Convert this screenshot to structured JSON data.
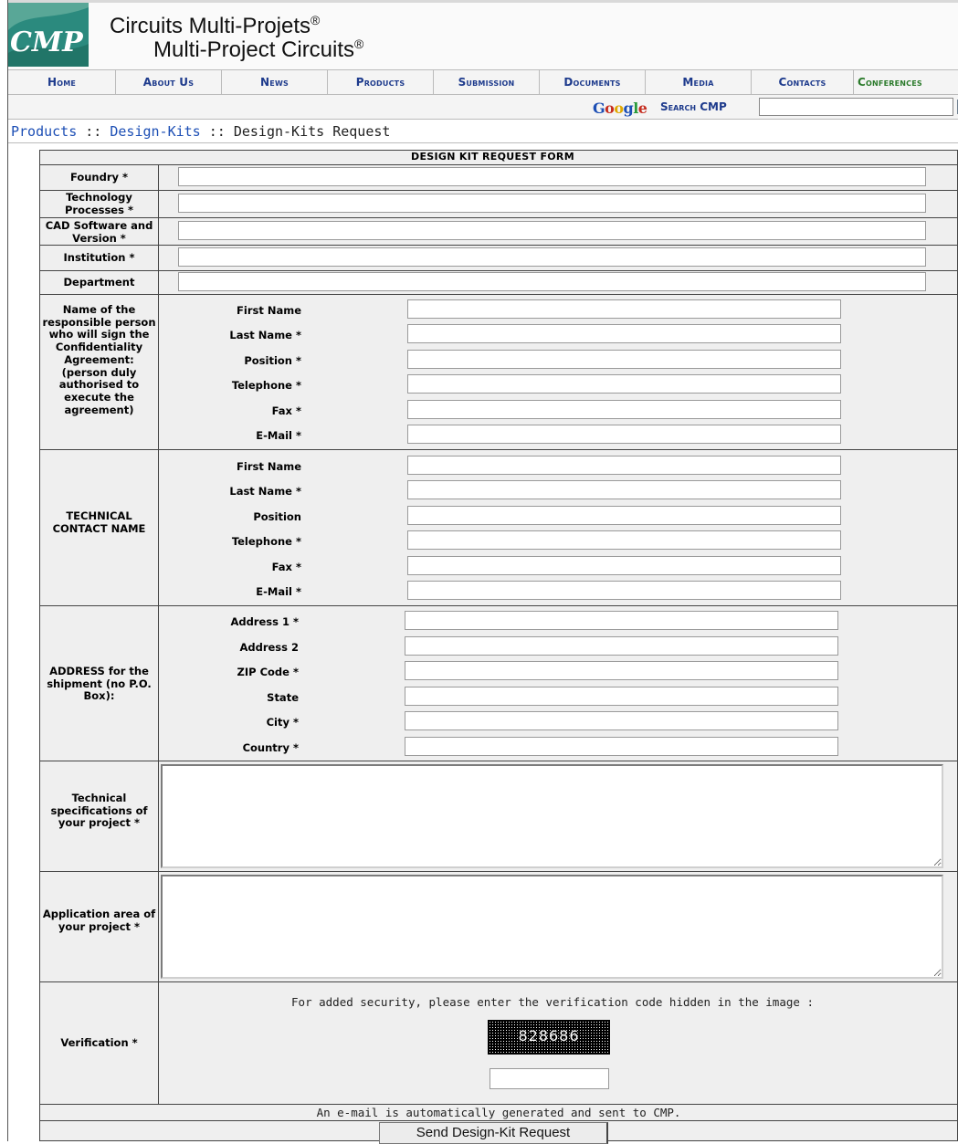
{
  "header": {
    "logo_text": "CMP",
    "title_line1": "Circuits Multi-Projets",
    "title_line2": "Multi-Project Circuits",
    "reg_mark": "®"
  },
  "nav": {
    "items": [
      "Home",
      "About Us",
      "News",
      "Products",
      "Submission",
      "Documents",
      "Media",
      "Contacts",
      "Conferences"
    ]
  },
  "search": {
    "google_label": "Google",
    "search_label": "Search CMP",
    "placeholder": ""
  },
  "breadcrumb": {
    "part1": "Products",
    "sep": " :: ",
    "part2": "Design-Kits",
    "part3": "Design-Kits Request"
  },
  "form": {
    "title": "DESIGN KIT REQUEST FORM",
    "fields": {
      "foundry": "Foundry *",
      "technology": "Technology Processes *",
      "cad": "CAD Software and Version *",
      "institution": "Institution *",
      "department": "Department"
    },
    "responsible": {
      "label": "Name of the responsible person who will sign the Confidentiality Agreement: (person duly authorised to execute the agreement)",
      "first_name": "First Name",
      "last_name": "Last Name *",
      "position": "Position *",
      "telephone": "Telephone *",
      "fax": "Fax *",
      "email": "E-Mail *"
    },
    "technical": {
      "label": "TECHNICAL CONTACT NAME",
      "first_name": "First Name",
      "last_name": "Last Name *",
      "position": "Position",
      "telephone": "Telephone *",
      "fax": "Fax *",
      "email": "E-Mail *"
    },
    "address": {
      "label": "ADDRESS for the shipment (no P.O. Box):",
      "address1": "Address 1 *",
      "address2": "Address 2",
      "zip": "ZIP Code *",
      "state": "State",
      "city": "City *",
      "country": "Country *"
    },
    "tech_spec_label": "Technical specifications of your project *",
    "application_label": "Application area of your project *",
    "verification": {
      "label": "Verification *",
      "instructions": "For added security, please enter the verification code hidden in the image :",
      "captcha_code": "828686"
    },
    "footnote": "An e-mail is automatically generated and sent to CMP.",
    "submit_label": "Send Design-Kit Request"
  }
}
